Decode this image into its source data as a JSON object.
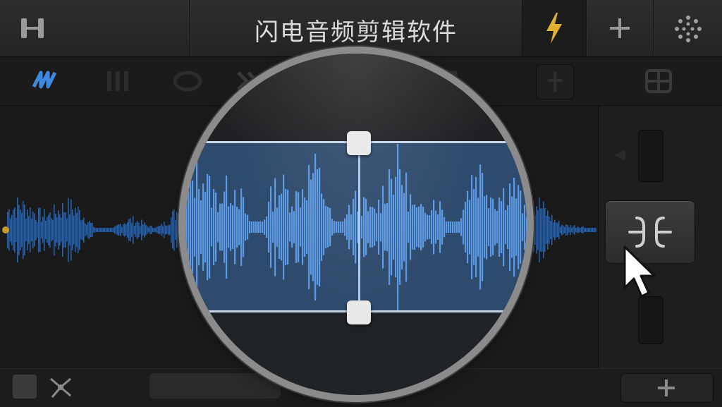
{
  "titlebar": {
    "title": "闪电音频剪辑软件",
    "left_icon": "pause-bars-icon",
    "flash_icon": "lightning-icon",
    "add_icon": "plus-icon",
    "settings_icon": "dots-circle-icon"
  },
  "toolbar": {
    "icons": [
      "waveform-logo-icon",
      "bars-icon",
      "mask-icon",
      "skip-icon",
      "split-icon",
      "add-marker-icon",
      "grid-icon"
    ]
  },
  "right_panel": {
    "center_button_icon": "split-point-icon",
    "slider_icon": "arrow-left-icon"
  },
  "bottombar": {
    "checkbox_icon": "checkbox-icon",
    "network_icon": "nodes-icon",
    "add_icon": "plus-icon"
  },
  "colors": {
    "waveform": "#3f7fd0",
    "waveform_bright": "#5a9ae6",
    "selection": "#2f4a6a",
    "accent": "#e0b030",
    "background": "#161616"
  }
}
